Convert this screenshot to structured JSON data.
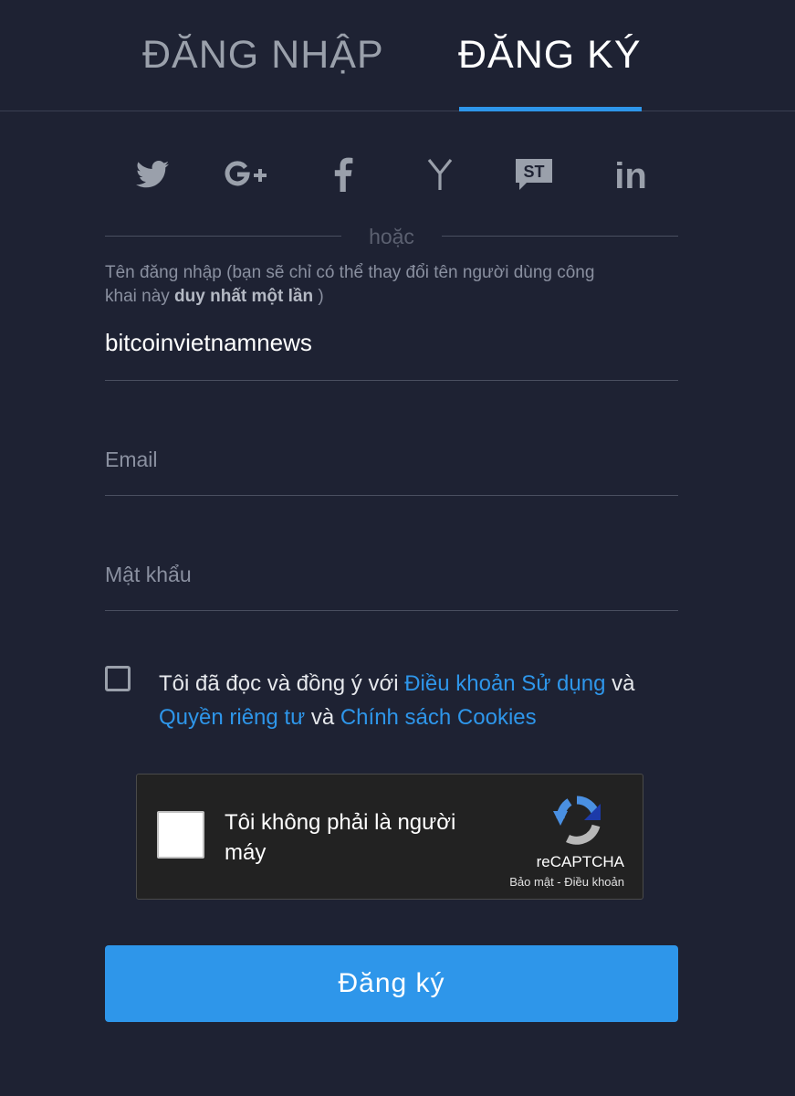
{
  "tabs": {
    "login": "ĐĂNG NHẬP",
    "signup": "ĐĂNG KÝ",
    "active": "signup"
  },
  "social": [
    {
      "icon": "twitter-icon"
    },
    {
      "icon": "google-plus-icon"
    },
    {
      "icon": "facebook-icon"
    },
    {
      "icon": "yahoo-icon"
    },
    {
      "icon": "stocktwits-icon",
      "text": "ST"
    },
    {
      "icon": "linkedin-icon",
      "text": "in"
    }
  ],
  "divider_text": "hoặc",
  "username": {
    "hint_part1": "Tên đăng nhập (bạn sẽ chỉ có thể thay đổi tên người dùng công khai này ",
    "hint_bold": "duy nhất một lần",
    "hint_part2": " )",
    "value": "bitcoinvietnamnews"
  },
  "email": {
    "placeholder": "Email"
  },
  "password": {
    "placeholder": "Mật khẩu"
  },
  "terms": {
    "prefix": "Tôi đã đọc và đồng ý với ",
    "link1": "Điều khoản Sử dụng",
    "and1": " và ",
    "link2": "Quyền riêng tư",
    "and2": " và ",
    "link3": "Chính sách Cookies"
  },
  "captcha": {
    "label": "Tôi không phải là người máy",
    "brand": "reCAPTCHA",
    "links": "Bảo mật - Điều khoản"
  },
  "submit_label": "Đăng ký",
  "colors": {
    "background": "#1e2233",
    "accent": "#2e96ea",
    "icon": "#9aa0ab"
  }
}
